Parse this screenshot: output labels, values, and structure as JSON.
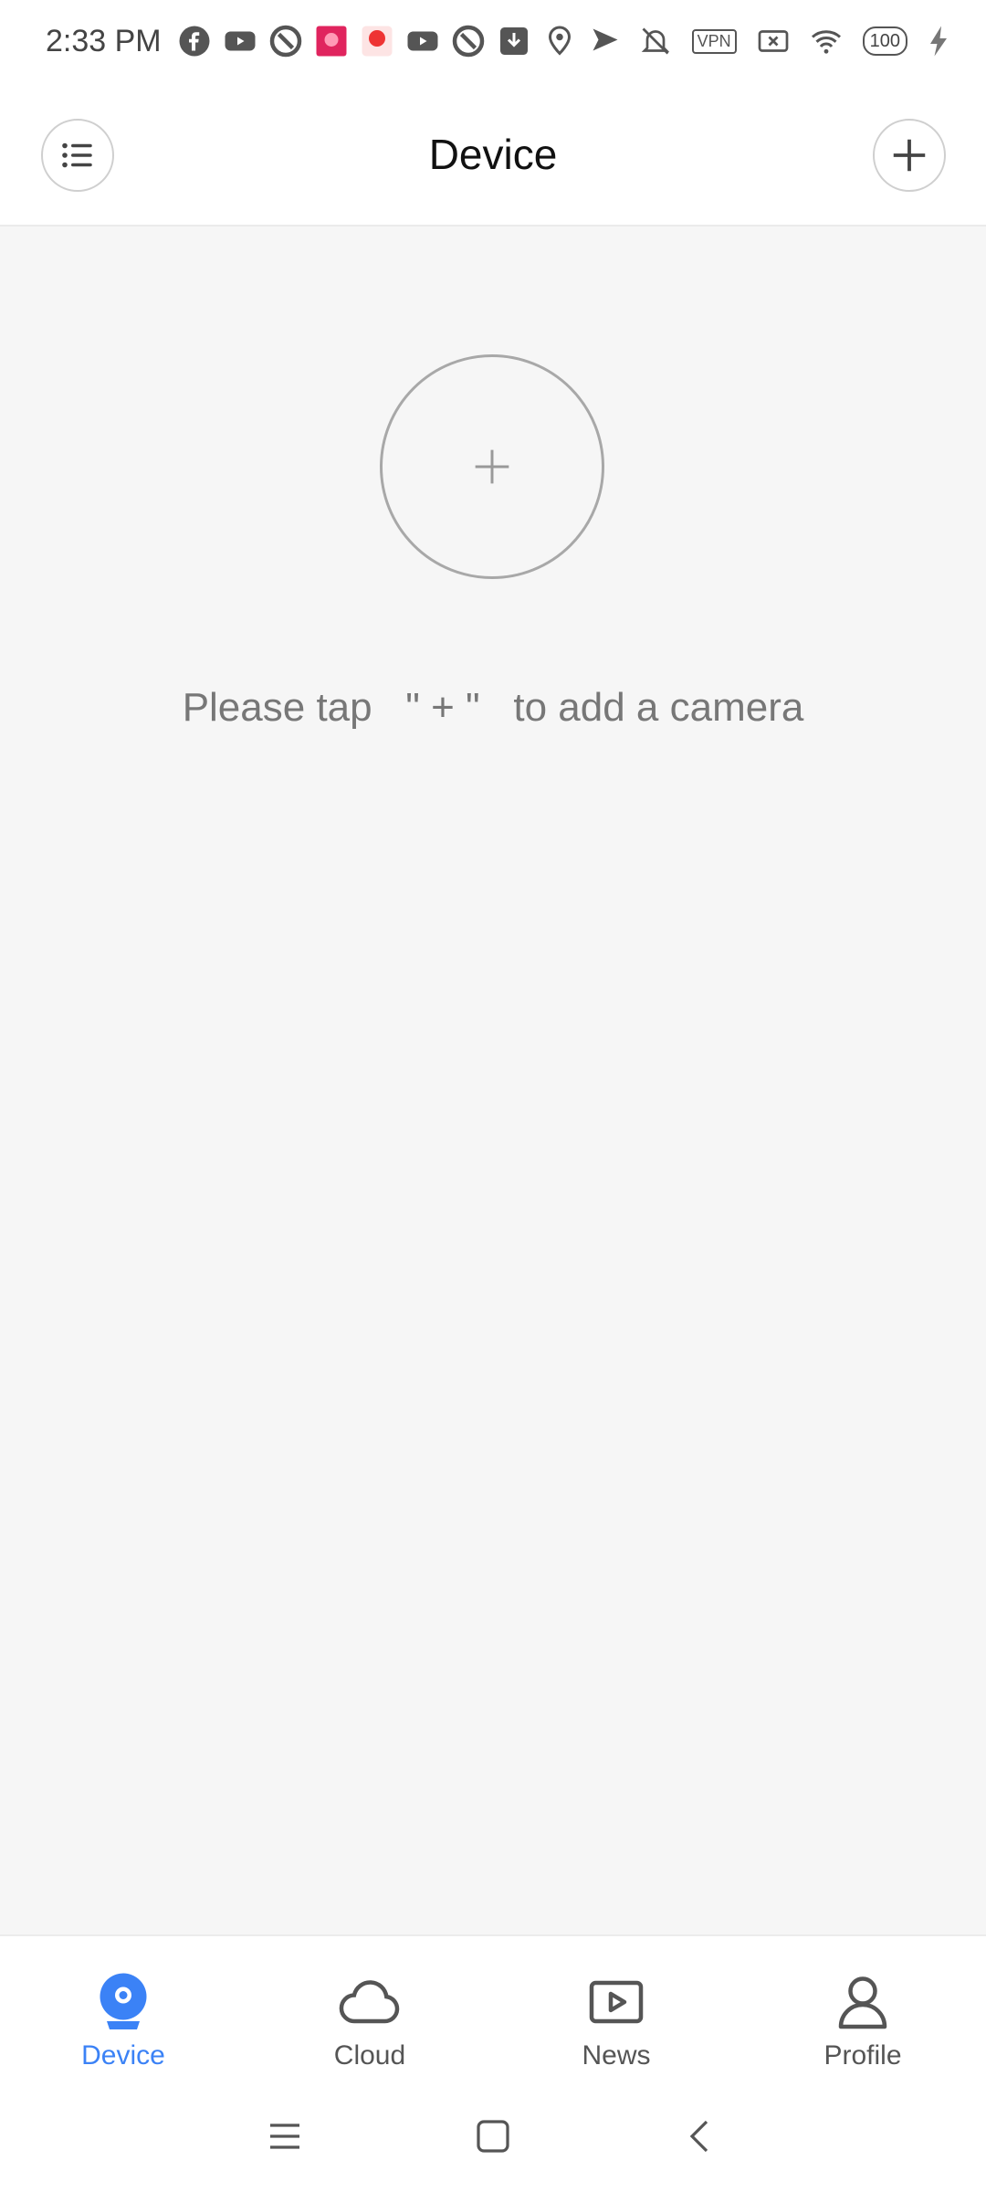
{
  "status_bar": {
    "time": "2:33 PM",
    "battery": "100",
    "vpn_label": "VPN",
    "icons_left": [
      "facebook-icon",
      "youtube-icon",
      "app-icon",
      "promo-app-icon",
      "promo-app-icon",
      "youtube-icon",
      "app-icon",
      "download-icon",
      "location-icon",
      "send-icon"
    ],
    "icons_right": [
      "bell-off-icon",
      "vpn-icon",
      "sim-off-icon",
      "wifi-icon",
      "battery-icon",
      "charging-icon"
    ]
  },
  "header": {
    "title": "Device",
    "menu_icon": "list-icon",
    "add_icon": "plus-icon"
  },
  "main": {
    "add_icon": "plus-icon",
    "hint": "Please tap   \" + \"   to add a camera"
  },
  "bottom_nav": {
    "active_color": "#3b82f6",
    "inactive_color": "#555555",
    "items": [
      {
        "label": "Device",
        "icon": "camera-icon",
        "active": true
      },
      {
        "label": "Cloud",
        "icon": "cloud-icon",
        "active": false
      },
      {
        "label": "News",
        "icon": "play-icon",
        "active": false
      },
      {
        "label": "Profile",
        "icon": "person-icon",
        "active": false
      }
    ]
  },
  "system_nav": [
    "menu-icon",
    "home-icon",
    "back-icon"
  ]
}
